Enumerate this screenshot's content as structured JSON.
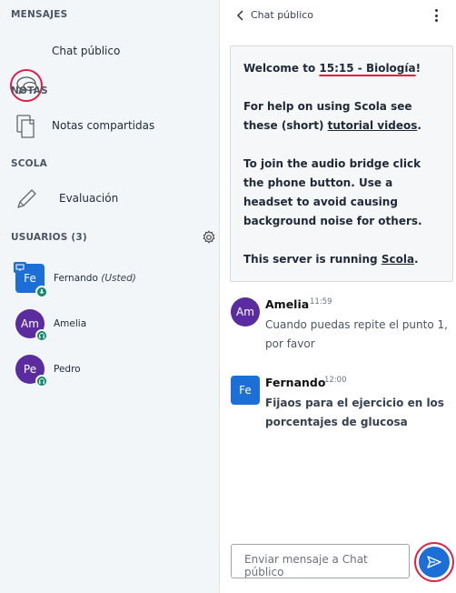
{
  "sidebar": {
    "sections": {
      "messages": "MENSAJES",
      "notes": "NOTAS",
      "scola": "SCOLA",
      "users": "USUARIOS (3)"
    },
    "public_chat": "Chat público",
    "shared_notes": "Notas compartidas",
    "evaluation": "Evaluación",
    "users": [
      {
        "initials": "Fe",
        "name": "Fernando",
        "suffix": "(Usted)",
        "color": "#1d6fd8",
        "status": "microphone"
      },
      {
        "initials": "Am",
        "name": "Amelia",
        "suffix": "",
        "color": "#5b2ca0",
        "status": "headset"
      },
      {
        "initials": "Pe",
        "name": "Pedro",
        "suffix": "",
        "color": "#5b2ca0",
        "status": "headset"
      }
    ]
  },
  "chat": {
    "title": "Chat público",
    "welcome": {
      "line1_prefix": "Welcome to ",
      "line1_room": "15:15 - Biología",
      "line1_suffix": "!",
      "help_prefix": "For help on using Scola see these (short) ",
      "help_link": "tutorial videos",
      "help_suffix": ".",
      "audio": "To join the audio bridge click the phone button. Use a headset to avoid causing background noise for others.",
      "server_prefix": "This server is running ",
      "server_link": "Scola",
      "server_suffix": "."
    },
    "messages": [
      {
        "initials": "Am",
        "name": "Amelia",
        "time": "11:59",
        "text": "Cuando puedas repite el punto 1, por favor",
        "color": "#5b2ca0"
      },
      {
        "initials": "Fe",
        "name": "Fernando",
        "time": "12:00",
        "text": "Fijaos para el ejercicio en los porcentajes de glucosa",
        "color": "#1d6fd8"
      }
    ],
    "input_placeholder": "Enviar mensaje a Chat público"
  },
  "colors": {
    "accent": "#1d6fd8",
    "highlight": "#e11d48",
    "status_green": "#0f8a6a"
  }
}
